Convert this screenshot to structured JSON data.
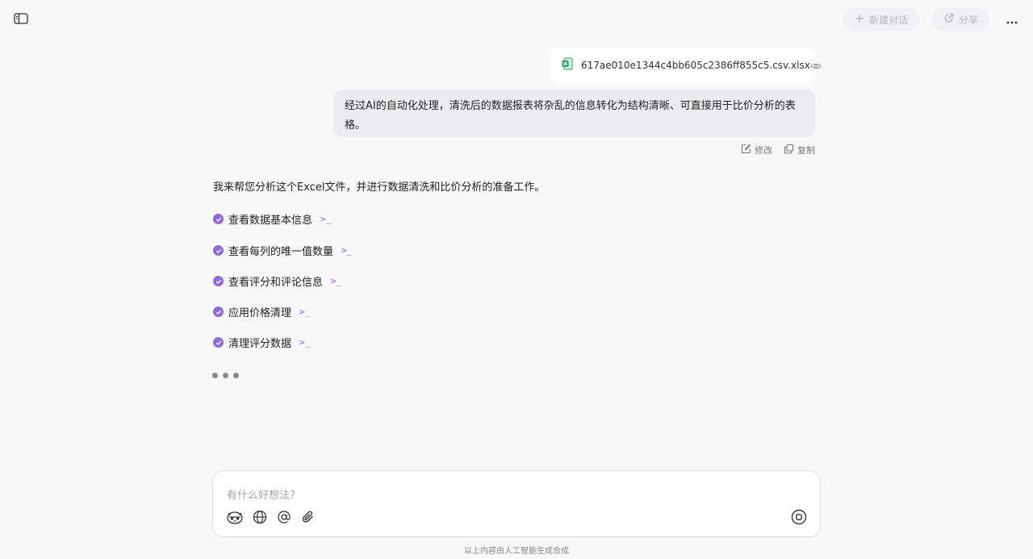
{
  "header": {
    "new_chat_label": "新建对话",
    "share_label": "分享"
  },
  "attachment": {
    "filename": "617ae010e1344c4bb605c2386ff855c5.csv.xlsx"
  },
  "user_message": {
    "text": "经过AI的自动化处理，清洗后的数据报表将杂乱的信息转化为结构清晰、可直接用于比价分析的表格。",
    "edit_label": "修改",
    "copy_label": "复制"
  },
  "assistant": {
    "intro": "我来帮您分析这个Excel文件，并进行数据清洗和比价分析的准备工作。",
    "steps": [
      {
        "label": "查看数据基本信息"
      },
      {
        "label": "查看每列的唯一值数量"
      },
      {
        "label": "查看评分和评论信息"
      },
      {
        "label": "应用价格清理"
      },
      {
        "label": "清理评分数据"
      }
    ],
    "terminal_glyph": ">_"
  },
  "composer": {
    "placeholder": "有什么好想法?"
  },
  "footer": {
    "disclaimer": "以上内容由人工智能生成合成"
  },
  "colors": {
    "accent": "#8f6bdc",
    "background": "#f8f8f9",
    "user_bubble": "#ececee"
  }
}
